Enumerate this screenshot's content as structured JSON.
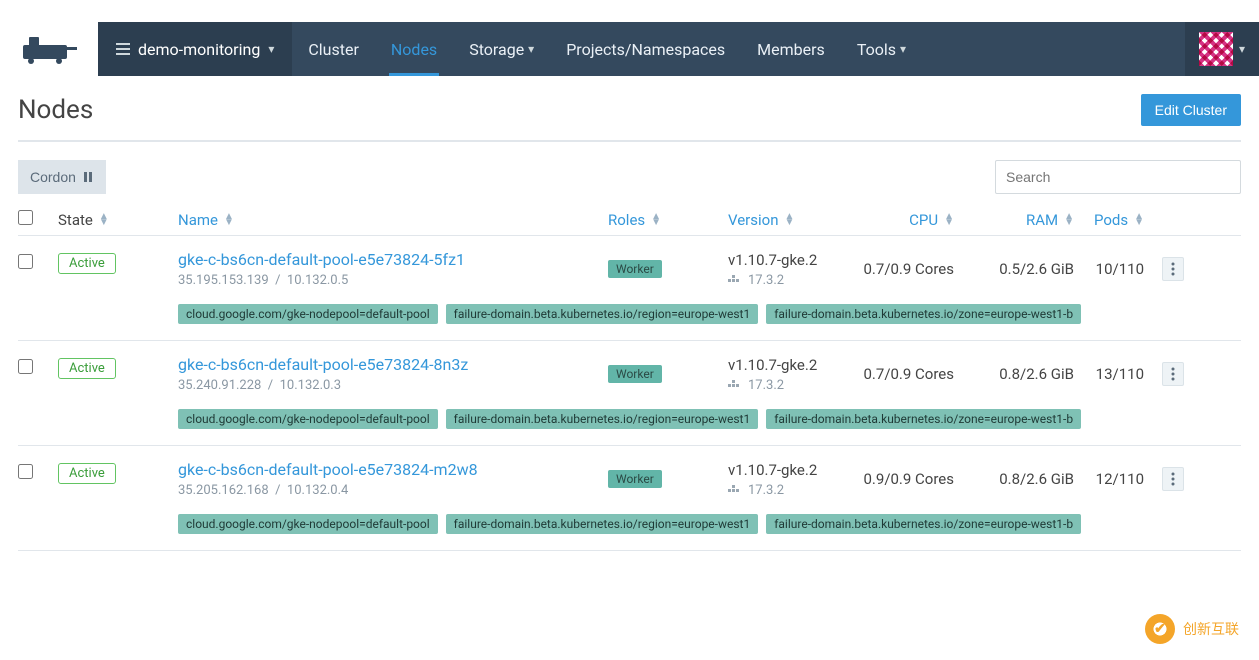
{
  "nav": {
    "cluster_name": "demo-monitoring",
    "items": [
      {
        "label": "Cluster"
      },
      {
        "label": "Nodes"
      },
      {
        "label": "Storage"
      },
      {
        "label": "Projects/Namespaces"
      },
      {
        "label": "Members"
      },
      {
        "label": "Tools"
      }
    ],
    "active_index": 1
  },
  "page": {
    "title": "Nodes",
    "edit_button": "Edit Cluster",
    "cordon_button": "Cordon",
    "search_placeholder": "Search"
  },
  "columns": {
    "state": "State",
    "name": "Name",
    "roles": "Roles",
    "version": "Version",
    "cpu": "CPU",
    "ram": "RAM",
    "pods": "Pods"
  },
  "nodes": [
    {
      "state": "Active",
      "name": "gke-c-bs6cn-default-pool-e5e73824-5fz1",
      "external_ip": "35.195.153.139",
      "internal_ip": "10.132.0.5",
      "role": "Worker",
      "k8s_version": "v1.10.7-gke.2",
      "docker_version": "17.3.2",
      "cpu": "0.7/0.9 Cores",
      "ram": "0.5/2.6 GiB",
      "pods": "10/110",
      "labels": [
        "cloud.google.com/gke-nodepool=default-pool",
        "failure-domain.beta.kubernetes.io/region=europe-west1",
        "failure-domain.beta.kubernetes.io/zone=europe-west1-b"
      ]
    },
    {
      "state": "Active",
      "name": "gke-c-bs6cn-default-pool-e5e73824-8n3z",
      "external_ip": "35.240.91.228",
      "internal_ip": "10.132.0.3",
      "role": "Worker",
      "k8s_version": "v1.10.7-gke.2",
      "docker_version": "17.3.2",
      "cpu": "0.7/0.9 Cores",
      "ram": "0.8/2.6 GiB",
      "pods": "13/110",
      "labels": [
        "cloud.google.com/gke-nodepool=default-pool",
        "failure-domain.beta.kubernetes.io/region=europe-west1",
        "failure-domain.beta.kubernetes.io/zone=europe-west1-b"
      ]
    },
    {
      "state": "Active",
      "name": "gke-c-bs6cn-default-pool-e5e73824-m2w8",
      "external_ip": "35.205.162.168",
      "internal_ip": "10.132.0.4",
      "role": "Worker",
      "k8s_version": "v1.10.7-gke.2",
      "docker_version": "17.3.2",
      "cpu": "0.9/0.9 Cores",
      "ram": "0.8/2.6 GiB",
      "pods": "12/110",
      "labels": [
        "cloud.google.com/gke-nodepool=default-pool",
        "failure-domain.beta.kubernetes.io/region=europe-west1",
        "failure-domain.beta.kubernetes.io/zone=europe-west1-b"
      ]
    }
  ],
  "watermark": "创新互联"
}
